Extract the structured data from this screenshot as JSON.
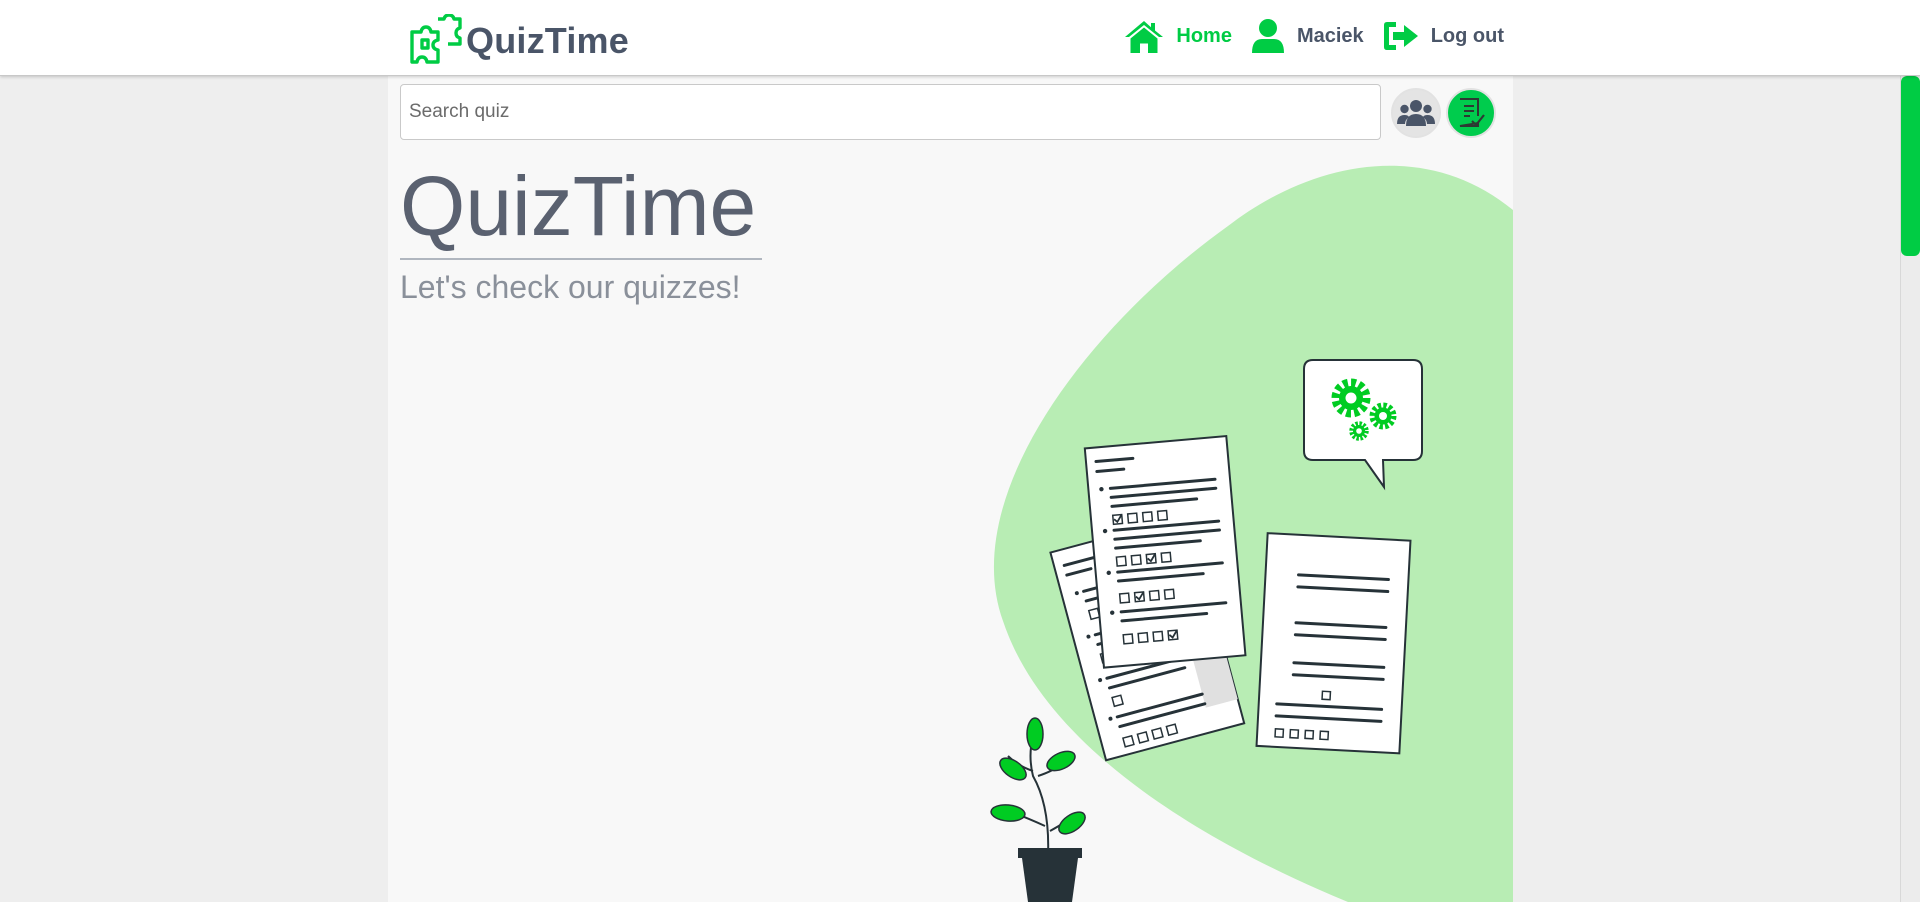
{
  "brand": {
    "name": "QuizTime",
    "logo_icon": "puzzle-icon"
  },
  "nav": {
    "home_label": "Home",
    "user_label": "Maciek",
    "logout_label": "Log out"
  },
  "search": {
    "placeholder": "Search quiz",
    "value": ""
  },
  "actions": {
    "users_icon": "users-icon",
    "quiz_icon": "quiz-list-icon"
  },
  "hero": {
    "title": "QuizTime",
    "subtitle": "Let's check our quizzes!"
  },
  "colors": {
    "accent": "#00cc44",
    "text_dark": "#4a5568",
    "blob": "#b8edb4",
    "page_bg": "#eeeeee",
    "content_bg": "#f8f8f8"
  }
}
